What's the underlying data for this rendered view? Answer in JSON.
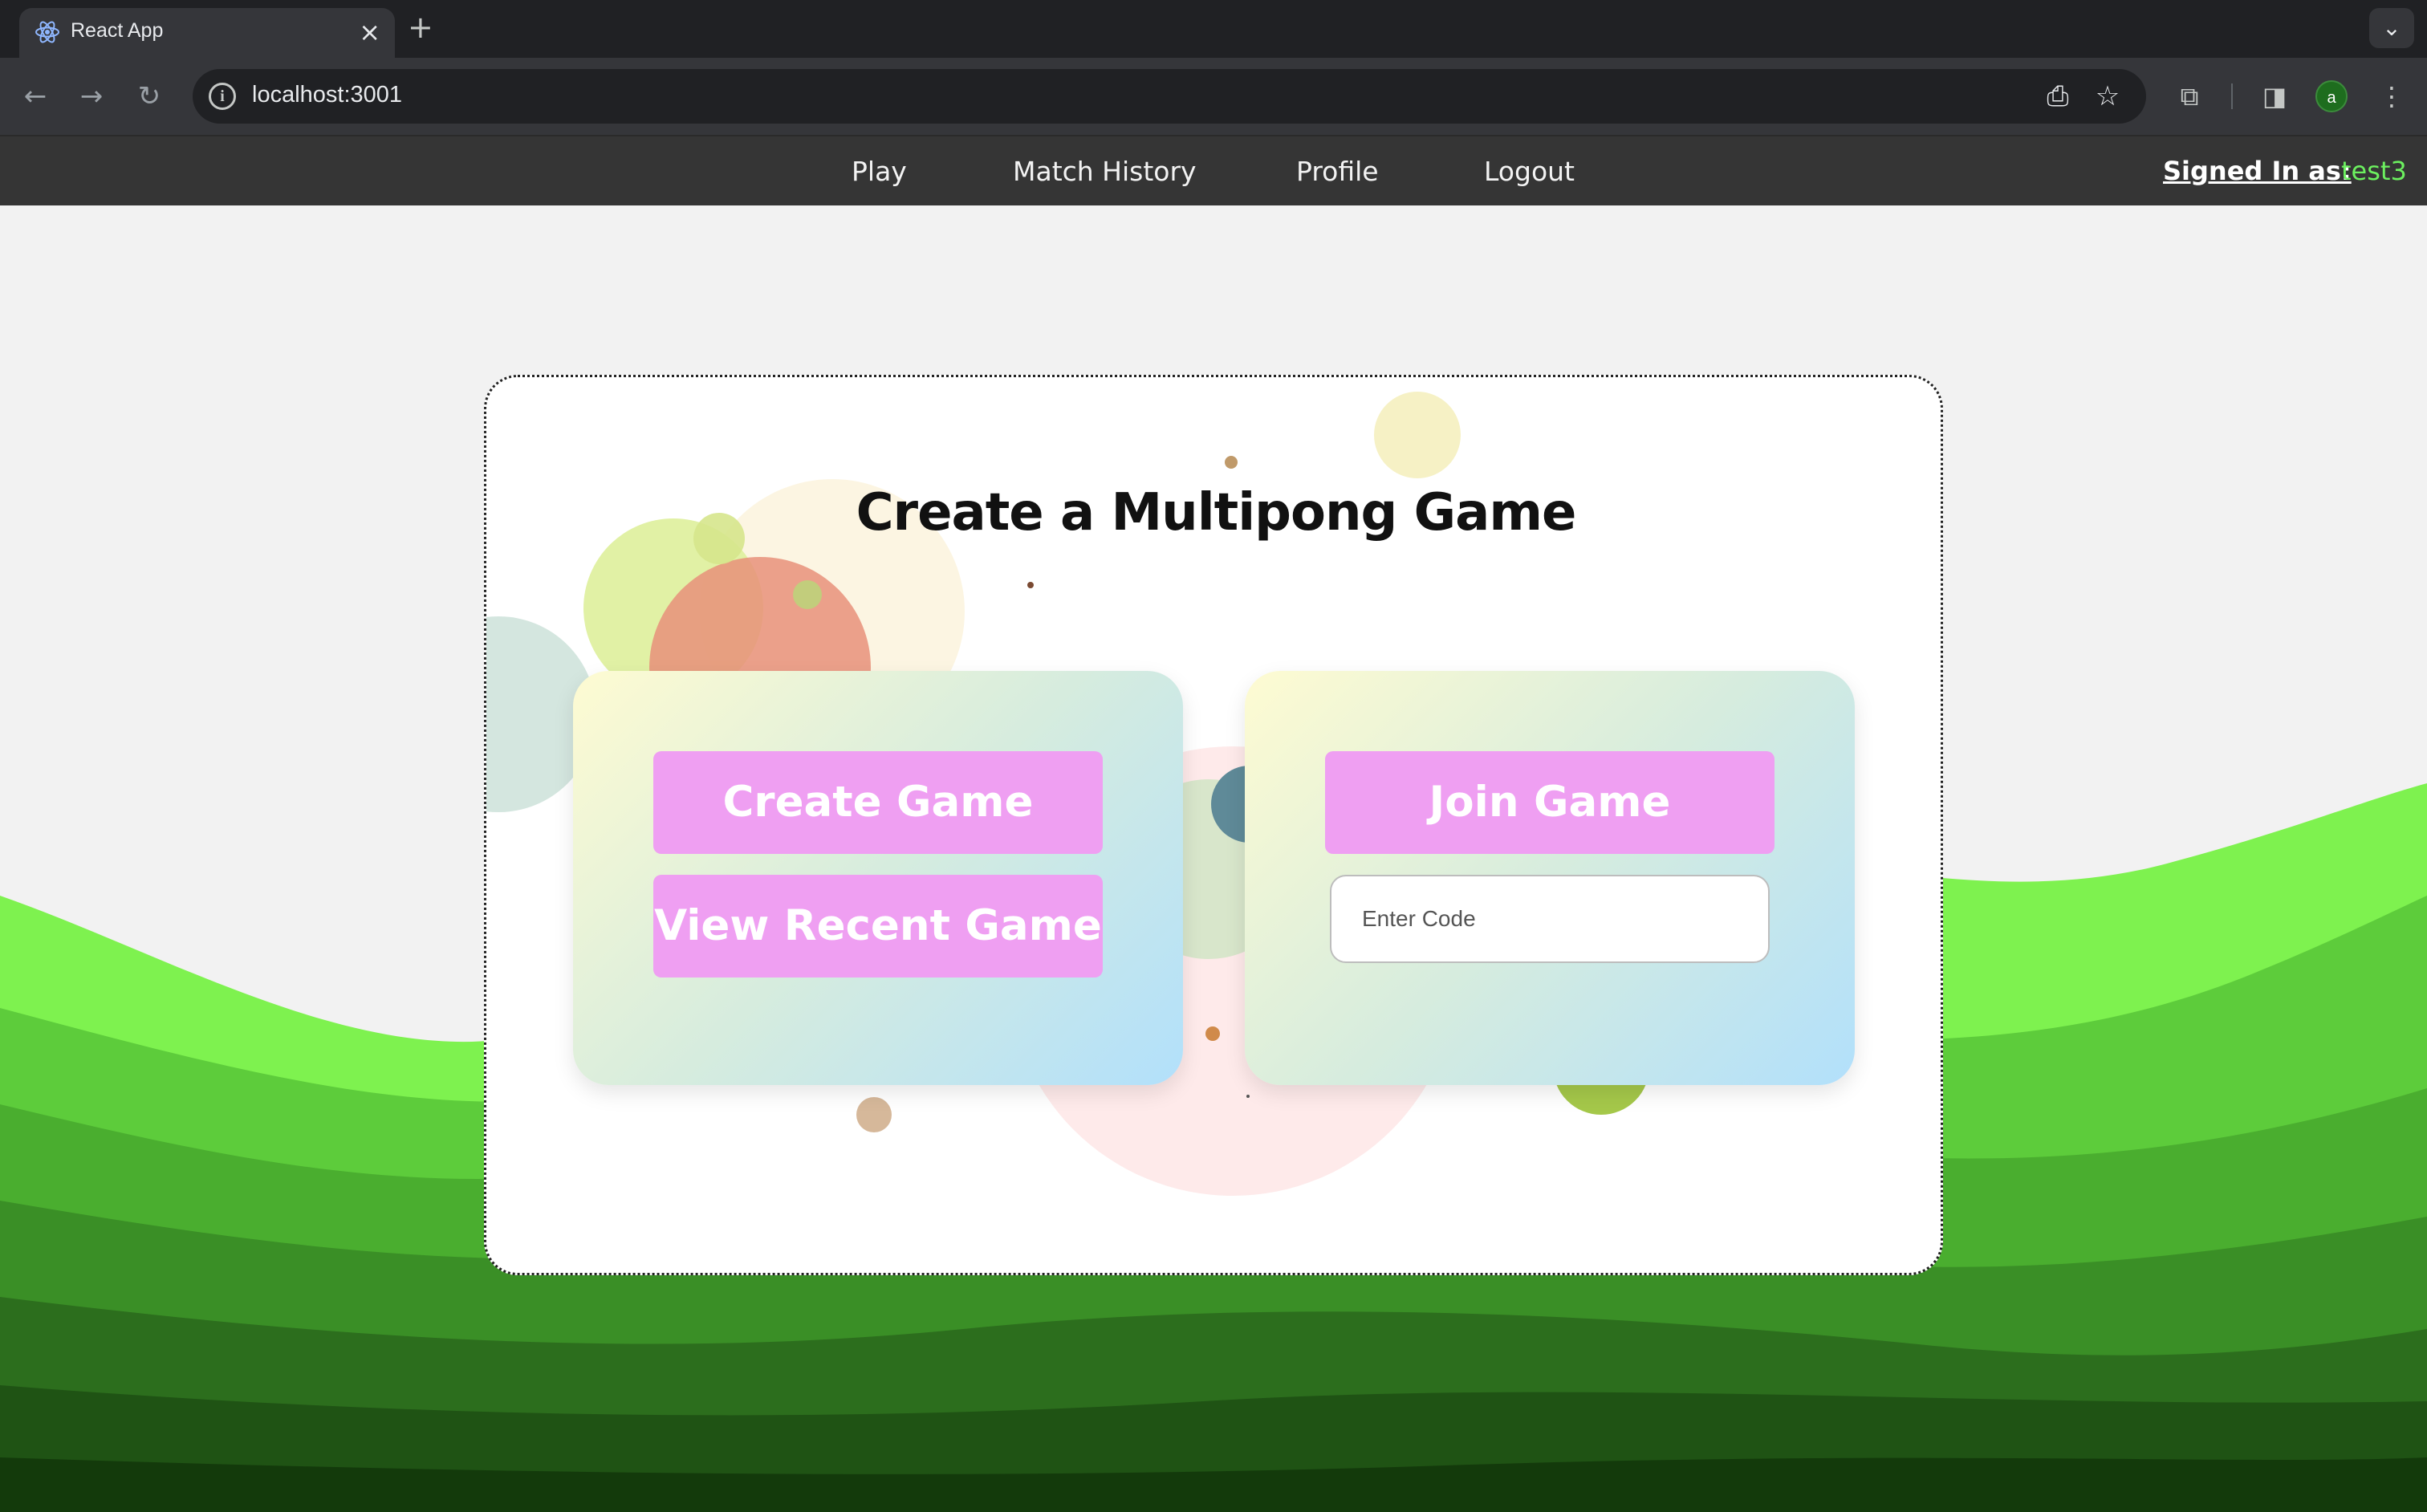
{
  "browser": {
    "tab_title": "React App",
    "url": "localhost:3001"
  },
  "navbar": {
    "links": [
      "Play",
      "Match History",
      "Profile",
      "Logout"
    ],
    "signed_in_label": "Signed In as:",
    "username": "test3"
  },
  "main": {
    "title": "Create a Multipong Game",
    "create_button": "Create Game",
    "view_recent_button": "View Recent Game",
    "join_button": "Join Game",
    "code_placeholder": "Enter Code"
  },
  "profile_avatar_letter": "a",
  "colors": {
    "button_pink": "#ef9ff2",
    "username_green": "#6cf05f",
    "navbar_bg": "#353535"
  }
}
